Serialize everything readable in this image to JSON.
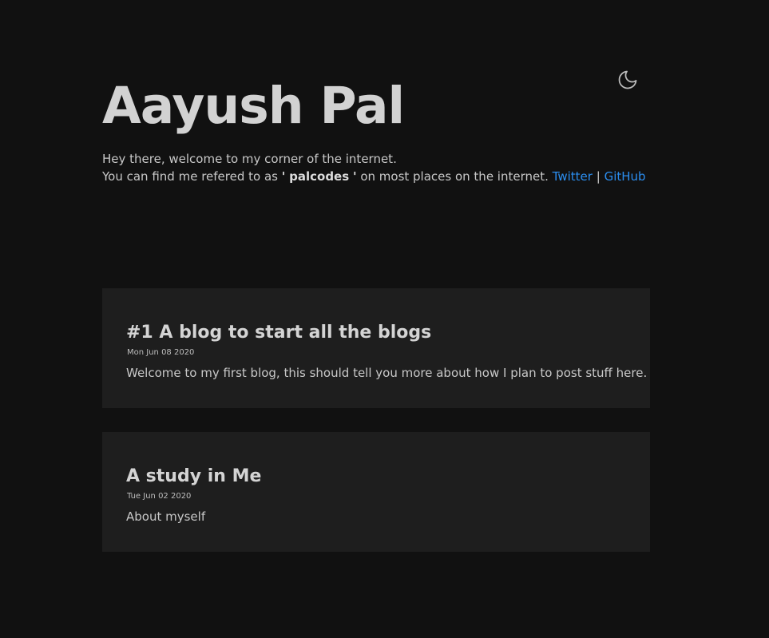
{
  "header": {
    "title": "Aayush Pal",
    "theme_toggle_icon": "moon-icon"
  },
  "intro": {
    "line1": "Hey there, welcome to my corner of the internet.",
    "line2_prefix": "You can find me refered to as",
    "quote_open": "'",
    "handle": "palcodes",
    "quote_close": "'",
    "line2_suffix": "on most places on the internet.",
    "twitter_label": "Twitter",
    "separator": "|",
    "github_label": "GitHub"
  },
  "posts": [
    {
      "title": "#1 A blog to start all the blogs",
      "date": "Mon Jun 08 2020",
      "excerpt": "Welcome to my first blog, this should tell you more about how I plan to post stuff here."
    },
    {
      "title": "A study in Me",
      "date": "Tue Jun 02 2020",
      "excerpt": "About myself"
    }
  ],
  "colors": {
    "background": "#111111",
    "card": "#1e1e1e",
    "link": "#2b8ef0",
    "text": "#cfcfcf"
  }
}
